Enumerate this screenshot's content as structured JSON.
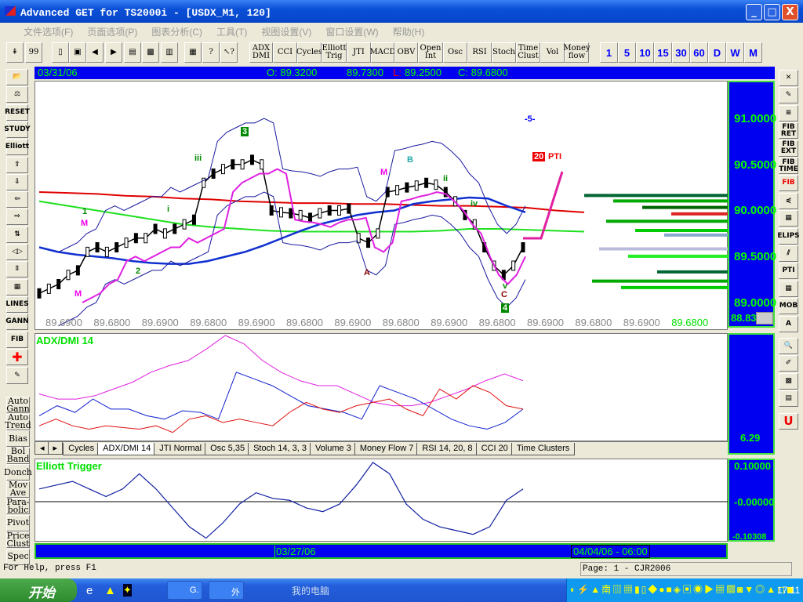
{
  "window": {
    "title": "Advanced GET for TS2000i - [USDX_M1, 120]",
    "min": "_",
    "max": "□",
    "close": "X"
  },
  "menu": [
    "文件选项(F)",
    "页面选项(P)",
    "图表分析(C)",
    "工具(T)",
    "视图设置(V)",
    "窗口设置(W)",
    "帮助(H)"
  ],
  "toolbar": {
    "study_buttons": [
      "ADX DMI",
      "CCI",
      "Cycles",
      "Elliott Trig",
      "JTI",
      "MACD",
      "OBV",
      "Open Int",
      "Osc",
      "RSI",
      "Stoch",
      "Time Clust",
      "Vol",
      "Money flow"
    ],
    "timeframes": [
      "1",
      "5",
      "10",
      "15",
      "30",
      "60",
      "D",
      "W",
      "M"
    ]
  },
  "infobar": {
    "date": "03/31/06",
    "open": "O: 89.3200",
    "high": "89.7300",
    "low_label": "L:",
    "low": "89.2500",
    "close": "C: 89.6800"
  },
  "left_tools": [
    "RESET",
    "STUDY",
    "Elliott",
    "LINES",
    "GANN",
    "FIB"
  ],
  "left_studies": [
    "Auto Gann",
    "Auto Trend",
    "Bias",
    "Bol Band",
    "Donch",
    "Mov Ave",
    "Para-bolic",
    "Pivot",
    "Price Clust",
    "Spec"
  ],
  "right_tools": [
    "FIB RET",
    "FIB EXT",
    "FIB TIME",
    "FIB",
    "ELIPS",
    "PTI",
    "MOB",
    "A"
  ],
  "price_axis": {
    "ticks": [
      "91.0000",
      "90.5000",
      "90.0000",
      "89.5000",
      "89.0000"
    ],
    "current": "88.8316"
  },
  "price_labels": [
    "89.6900",
    "89.6800",
    "89.6900",
    "89.6800",
    "89.6900",
    "89.6800",
    "89.6900",
    "89.6800",
    "89.6900",
    "89.6800",
    "89.6900",
    "89.6800",
    "89.6900",
    "89.6800"
  ],
  "wave_labels": {
    "w3": "3",
    "w4": "4",
    "w5": "-5-",
    "pti_value": "20",
    "pti": "PTI",
    "A": "A",
    "B": "B",
    "C": "C",
    "one": "1",
    "two": "2",
    "M": "M",
    "iii": "iii",
    "iv": "iv",
    "ii": "ii",
    "i": "i",
    "v": "v"
  },
  "adx": {
    "title": "ADX/DMI 14",
    "value": "6.29"
  },
  "tabs": [
    "Cycles",
    "ADX/DMI 14",
    "JTI Normal",
    "Osc 5,35",
    "Stoch 14, 3, 3",
    "Volume 3",
    "Money Flow 7",
    "RSI 14, 20, 8",
    "CCI 20",
    "Time Clusters"
  ],
  "active_tab": "ADX/DMI 14",
  "elliott": {
    "title": "Elliott Trigger",
    "ticks": [
      "0.10000",
      "-0.00000"
    ],
    "bottom": "-0.10308"
  },
  "datebar": {
    "left": "03/27/06",
    "right": "04/04/06 - 06:00"
  },
  "status": {
    "help": "For Help, press F1",
    "page": "Page: 1 - CJR2006"
  },
  "taskbar": {
    "start": "开始",
    "tasks": [
      "G.",
      "外"
    ],
    "mycomputer": "我的电脑",
    "clock": "17:11"
  },
  "colors": {
    "axis_bg": "#0000f0",
    "axis_text": "#00ff00",
    "title": "#0a4fd8"
  },
  "chart_data": {
    "type": "line",
    "price": {
      "ylim": [
        88.85,
        91.3
      ],
      "close": [
        89.1,
        89.15,
        89.2,
        89.3,
        89.35,
        89.55,
        89.6,
        89.55,
        89.6,
        89.65,
        89.7,
        89.7,
        89.8,
        89.75,
        89.8,
        89.85,
        89.9,
        90.3,
        90.4,
        90.45,
        90.5,
        90.5,
        90.55,
        90.5,
        90.0,
        89.98,
        89.97,
        89.95,
        89.92,
        89.97,
        90.0,
        90.0,
        90.02,
        89.7,
        89.65,
        89.75,
        90.2,
        90.22,
        90.25,
        90.27,
        90.3,
        90.28,
        90.2,
        90.1,
        89.95,
        89.85,
        89.6,
        89.4,
        89.3,
        89.4,
        89.6
      ],
      "ma_blue": [
        89.6,
        89.55,
        89.52,
        89.5,
        89.48,
        89.45,
        89.43,
        89.42,
        89.42,
        89.45,
        89.5,
        89.55,
        89.62,
        89.7,
        89.78,
        89.85,
        89.9,
        89.95,
        89.98,
        90.0,
        90.07,
        90.1,
        90.12,
        90.14,
        90.13,
        90.05,
        89.98
      ],
      "ma_red": [
        90.2,
        90.19,
        90.18,
        90.16,
        90.15,
        90.13,
        90.12,
        90.1,
        90.09,
        90.08,
        90.08,
        90.07,
        90.07,
        90.06,
        90.05,
        90.05,
        90.04,
        90.03,
        90.0,
        89.98
      ],
      "ma_green": [
        90.1,
        90.05,
        90.0,
        89.95,
        89.9,
        89.85,
        89.82,
        89.8,
        89.78,
        89.77,
        89.77,
        89.77,
        89.77,
        89.77,
        89.78,
        89.8,
        89.8,
        89.79,
        89.78,
        89.77
      ]
    },
    "adx": {
      "ylim": [
        0,
        60
      ],
      "adx": [
        25,
        22,
        22,
        24,
        28,
        32,
        38,
        42,
        45,
        52,
        60,
        55,
        45,
        38,
        33,
        30,
        30,
        25,
        20,
        18,
        18,
        20,
        24,
        28,
        33,
        37,
        33
      ],
      "plus_di": [
        12,
        18,
        14,
        22,
        16,
        16,
        12,
        10,
        15,
        14,
        10,
        38,
        34,
        30,
        24,
        18,
        16,
        14,
        10,
        30,
        26,
        22,
        16,
        10,
        6,
        4,
        8,
        16
      ],
      "minus_di": [
        6,
        10,
        6,
        4,
        6,
        5,
        4,
        6,
        2,
        10,
        12,
        8,
        10,
        8,
        6,
        14,
        20,
        16,
        14,
        18,
        20,
        22,
        16,
        12,
        28,
        22,
        30,
        26,
        18,
        16
      ]
    },
    "elliott": {
      "ylim": [
        -0.10308,
        0.1
      ],
      "values": [
        0.03,
        0.04,
        0.05,
        0.03,
        0.01,
        0.03,
        0.07,
        0.03,
        -0.02,
        -0.07,
        -0.1,
        -0.06,
        -0.01,
        0.02,
        0.005,
        0.0,
        -0.02,
        -0.03,
        -0.01,
        0.04,
        0.1,
        0.07,
        -0.01,
        -0.05,
        -0.07,
        -0.08,
        -0.09,
        -0.07,
        0.0,
        0.03
      ]
    }
  }
}
